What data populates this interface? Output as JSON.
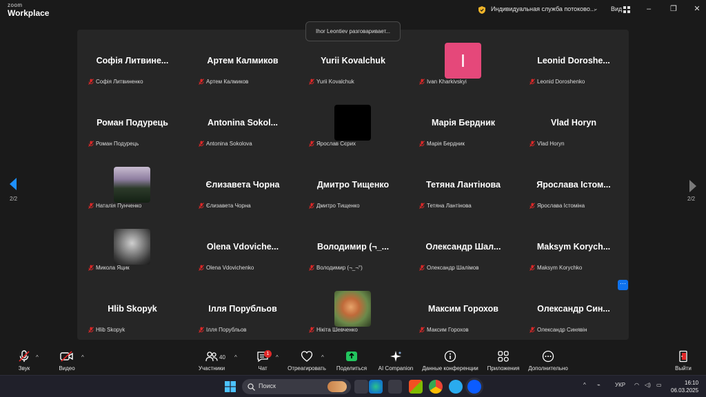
{
  "app": {
    "logo_small": "zoom",
    "logo_big": "Workplace",
    "service_name": "Индивидуальная служба потоково...",
    "view_label": "Вид"
  },
  "speaking_text": "Ihor Leontiev разговаривает...",
  "pager": {
    "left": "2/2",
    "right": "2/2"
  },
  "participants": [
    {
      "display": "Софія Литвине...",
      "name": "Софія Литвиненко",
      "avatar": "none"
    },
    {
      "display": "Артем Калмиков",
      "name": "Артем Калмиков",
      "avatar": "none"
    },
    {
      "display": "Yurii Kovalchuk",
      "name": "Yurii Kovalchuk",
      "avatar": "none"
    },
    {
      "display": "",
      "name": "Ivan Kharkivskyi",
      "avatar": "letter",
      "letter": "I"
    },
    {
      "display": "Leonid Doroshe...",
      "name": "Leonid Doroshenko",
      "avatar": "none"
    },
    {
      "display": "Роман Подурець",
      "name": "Роман Подурець",
      "avatar": "none"
    },
    {
      "display": "Antonina Sokol...",
      "name": "Antonina Sokolova",
      "avatar": "none"
    },
    {
      "display": "",
      "name": "Ярослав Сєрих",
      "avatar": "black"
    },
    {
      "display": "Марія Бердник",
      "name": "Марія Бердник",
      "avatar": "none"
    },
    {
      "display": "Vlad Horyn",
      "name": "Vlad Horyn",
      "avatar": "none"
    },
    {
      "display": "",
      "name": "Наталія Пунченко",
      "avatar": "forest"
    },
    {
      "display": "Єлизавета Чорна",
      "name": "Єлизавета Чорна",
      "avatar": "none"
    },
    {
      "display": "Дмитро Тищенко",
      "name": "Дмитро Тищенко",
      "avatar": "none"
    },
    {
      "display": "Тетяна Лантінова",
      "name": "Тетяна Лантінова",
      "avatar": "none"
    },
    {
      "display": "Ярослава Істом...",
      "name": "Ярослава Істоміна",
      "avatar": "none"
    },
    {
      "display": "",
      "name": "Микола Яцик",
      "avatar": "man"
    },
    {
      "display": "Olena Vdoviche...",
      "name": "Olena Vdovichenko",
      "avatar": "none"
    },
    {
      "display": "Володимир (¬_...",
      "name": "Володимир (¬_¬°)",
      "avatar": "none"
    },
    {
      "display": "Олександр Шал...",
      "name": "Олександр Шалімов",
      "avatar": "none"
    },
    {
      "display": "Maksym Korych...",
      "name": "Maksym Korychko",
      "avatar": "none"
    },
    {
      "display": "Hlib Skopyk",
      "name": "Hlib Skopyk",
      "avatar": "none"
    },
    {
      "display": "Ілля Порубльов",
      "name": "Ілля Порубльов",
      "avatar": "none"
    },
    {
      "display": "",
      "name": "Нікіта Шевченко",
      "avatar": "food"
    },
    {
      "display": "Максим Горохов",
      "name": "Максим Горохов",
      "avatar": "none"
    },
    {
      "display": "Олександр Син...",
      "name": "Олександр Синявін",
      "avatar": "none"
    }
  ],
  "more_dots": "···",
  "toolbar": {
    "audio": "Звук",
    "video": "Видео",
    "participants": "Участники",
    "participants_count": "40",
    "chat": "Чат",
    "chat_badge": "1",
    "react": "Отреагировать",
    "share": "Поделиться",
    "ai": "AI Companion",
    "meeting_info": "Данные конференции",
    "apps": "Приложения",
    "more": "Дополнительно",
    "leave": "Выйти"
  },
  "taskbar": {
    "search_placeholder": "Поиск",
    "lang": "УКР",
    "time": "16:10",
    "date": "06.03.2025"
  },
  "colors": {
    "accent": "#0e72ed",
    "muted_red": "#e02828",
    "avatar_pink": "#e5487a",
    "share_green": "#22c55e"
  }
}
